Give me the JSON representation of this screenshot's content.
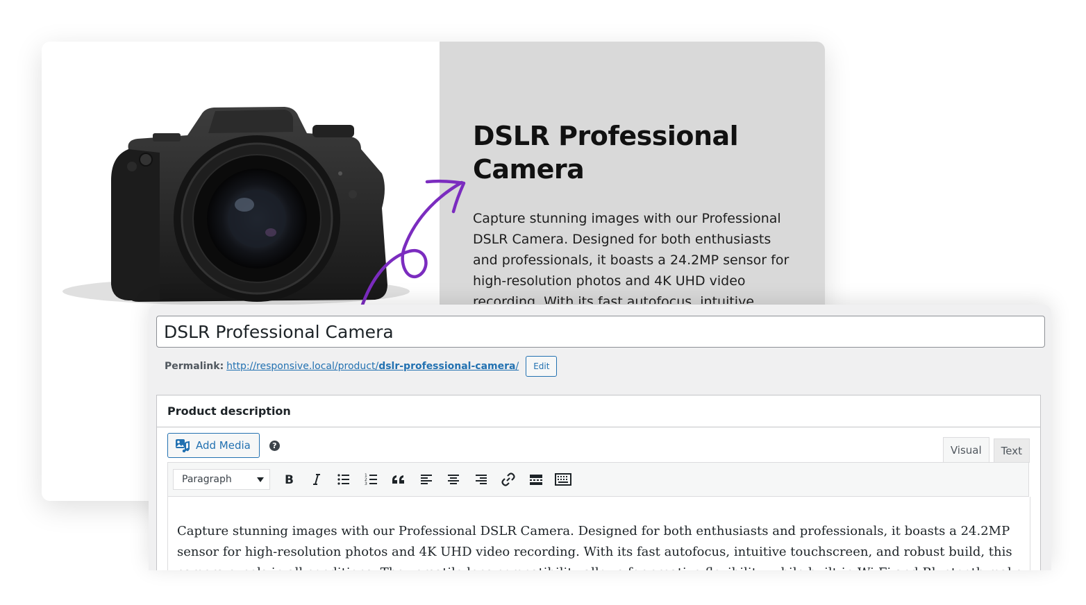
{
  "product_card": {
    "title": "DSLR Professional Camera",
    "description": "Capture stunning images with our Professional DSLR Camera. Designed for both enthusiasts and professionals, it boasts a 24.2MP sensor for high-resolution photos and 4K UHD video recording. With its fast autofocus, intuitive touchscreen, and robust build, this camera excels in all conditions."
  },
  "editor": {
    "title_value": "DSLR Professional Camera",
    "permalink": {
      "label": "Permalink:",
      "url_base": "http://responsive.local/product/",
      "slug": "dslr-professional-camera",
      "url_end": "/",
      "edit_label": "Edit"
    },
    "section_title": "Product description",
    "add_media_label": "Add Media",
    "help_symbol": "?",
    "tabs": [
      {
        "label": "Visual",
        "active": true
      },
      {
        "label": "Text",
        "active": false
      }
    ],
    "format_select": "Paragraph",
    "toolbar_buttons": [
      "bold-icon",
      "italic-icon",
      "bullet-list-icon",
      "numbered-list-icon",
      "blockquote-icon",
      "align-left-icon",
      "align-center-icon",
      "align-right-icon",
      "link-icon",
      "read-more-icon",
      "toolbar-toggle-icon"
    ],
    "content": "Capture stunning images with our Professional DSLR Camera. Designed for both enthusiasts and professionals, it boasts a 24.2MP sensor for high-resolution photos and 4K UHD video recording. With its fast autofocus, intuitive touchscreen, and robust build, this camera excels in all conditions. The versatile lens compatibility allows for creative flexibility, while built-in Wi-Fi and Bluetooth make sharing easy."
  },
  "colors": {
    "accent_purple": "#7b2cbf",
    "wp_blue": "#2271b1",
    "card_gray": "#d9d9d9"
  }
}
